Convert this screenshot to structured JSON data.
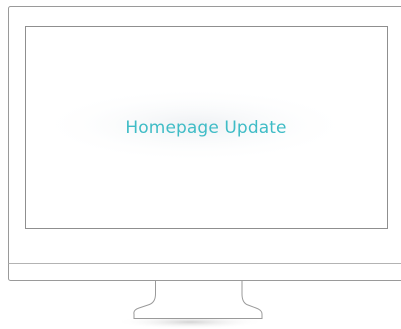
{
  "screen": {
    "headline": "Homepage Update"
  },
  "colors": {
    "headline": "#3fbcc6",
    "frame_stroke": "#9a9a9a",
    "screen_glow": "#f4f6f8"
  },
  "icons": {
    "device": "desktop-monitor-icon"
  }
}
